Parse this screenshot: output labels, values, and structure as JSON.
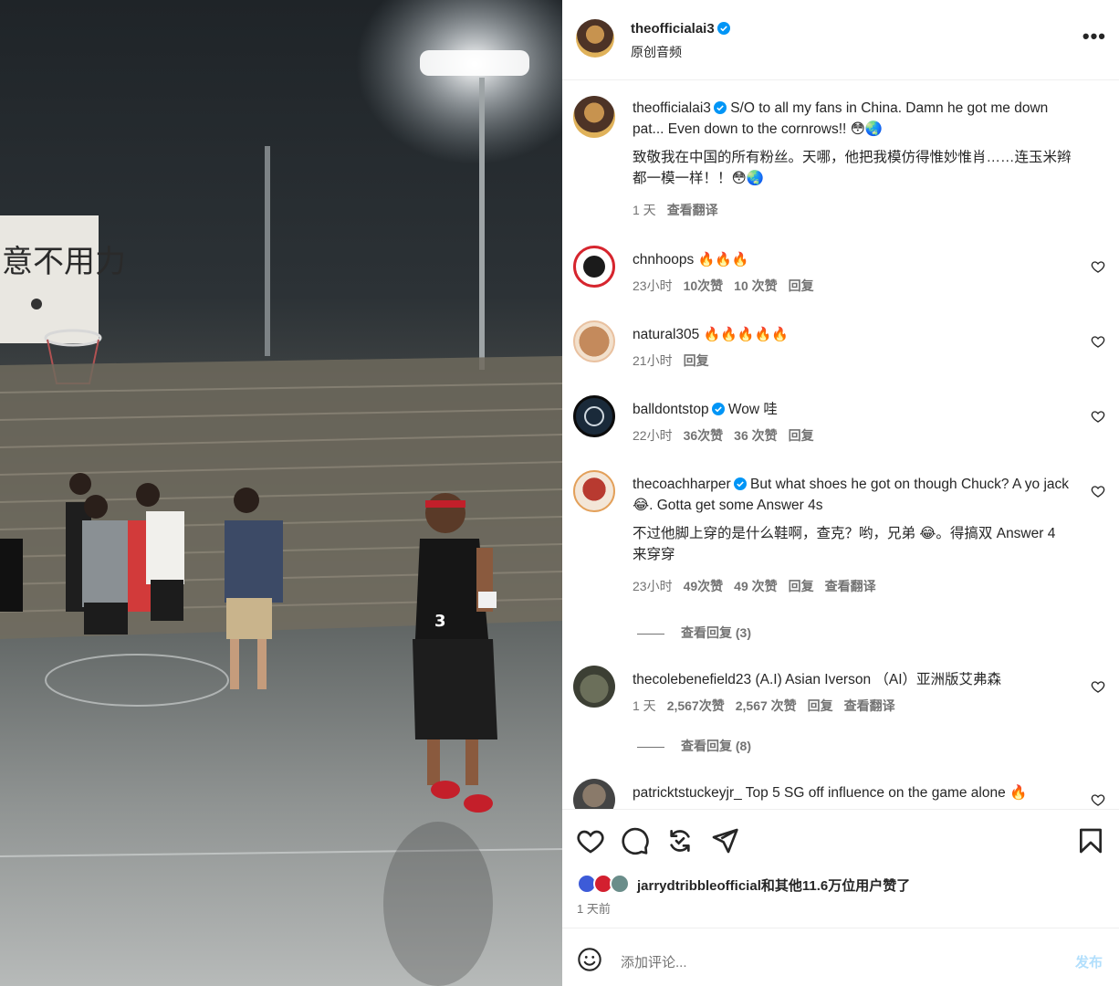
{
  "media": {
    "sign_text": "意不用力",
    "jersey_number": "3"
  },
  "header": {
    "username": "theofficialai3",
    "audio_label": "原创音频",
    "more_icon": "more-horizontal-icon"
  },
  "caption": {
    "username": "theofficialai3",
    "text_en": "S/O to all my fans in China. Damn he got me down pat... Even down to the cornrows!! 😳🌏",
    "text_zh": "致敬我在中国的所有粉丝。天哪，他把我模仿得惟妙惟肖……连玉米辫都一模一样！！😳🌏",
    "time": "1 天",
    "translate": "查看翻译"
  },
  "comments": [
    {
      "username": "chnhoops",
      "verified": false,
      "text": "🔥🔥🔥",
      "time": "23小时",
      "likes": "10次赞",
      "likes2": "10 次赞",
      "reply": "回复",
      "translate": "",
      "avatar_color": "#d6252e"
    },
    {
      "username": "natural305",
      "verified": false,
      "text": "🔥🔥🔥🔥🔥",
      "time": "21小时",
      "likes": "",
      "likes2": "",
      "reply": "回复",
      "translate": "",
      "avatar_color": "#c48a5c"
    },
    {
      "username": "balldontstop",
      "verified": true,
      "text": "Wow  哇",
      "time": "22小时",
      "likes": "36次赞",
      "likes2": "36 次赞",
      "reply": "回复",
      "translate": "",
      "avatar_color": "#1a2a3a"
    },
    {
      "username": "thecoachharper",
      "verified": true,
      "text": "But what shoes he got on though Chuck? A yo jack 😂. Gotta get some Answer 4s",
      "text_zh": "不过他脚上穿的是什么鞋啊，查克？哟，兄弟 😂。得搞双 Answer 4 来穿穿",
      "time": "23小时",
      "likes": "49次赞",
      "likes2": "49 次赞",
      "reply": "回复",
      "translate": "查看翻译",
      "view_replies": "查看回复 (3)",
      "avatar_color": "#b83a30"
    },
    {
      "username": "thecolebenefield23",
      "verified": false,
      "text": "(A.I) Asian Iverson  （AI）亚洲版艾弗森",
      "time": "1 天",
      "likes": "2,567次赞",
      "likes2": "2,567 次赞",
      "reply": "回复",
      "translate": "查看翻译",
      "view_replies": "查看回复 (8)",
      "avatar_color": "#6b6f5a"
    },
    {
      "username": "patricktstuckeyjr_",
      "verified": false,
      "text": "Top 5 SG off influence on the game alone 🔥",
      "avatar_color": "#444"
    }
  ],
  "actions": {
    "icons": [
      "heart-icon",
      "comment-icon",
      "repost-icon",
      "share-icon",
      "bookmark-icon"
    ],
    "liked_by_user": "jarrydtribbleofficial",
    "liked_by_rest": "和其他11.6万位用户赞了",
    "posted_ago": "1 天前"
  },
  "add_comment": {
    "placeholder": "添加评论...",
    "post_label": "发布"
  },
  "colors": {
    "verified": "#0095f6",
    "secondary_text": "#737373",
    "post_disabled": "#b2dffc"
  }
}
